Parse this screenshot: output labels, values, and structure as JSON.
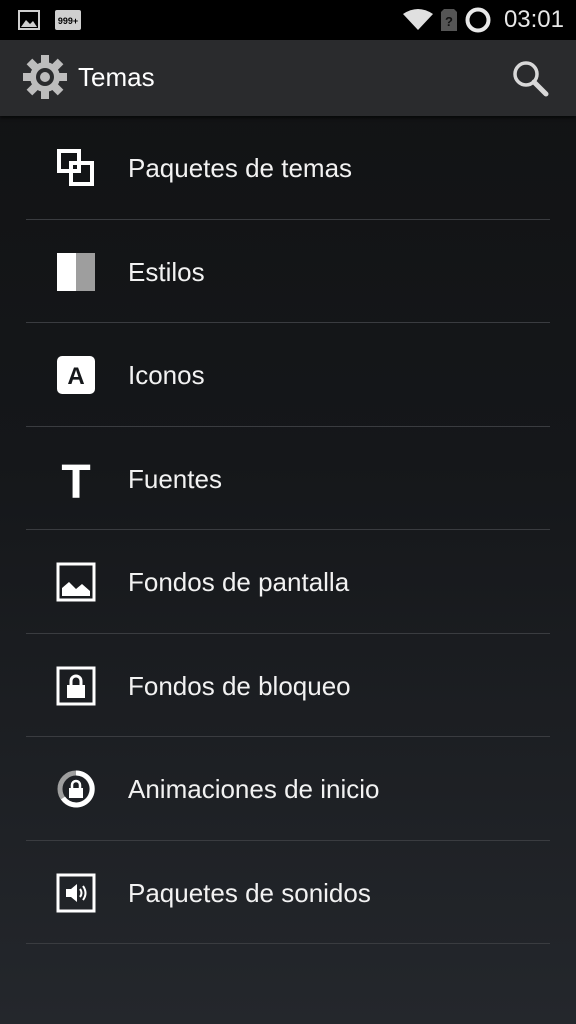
{
  "status_bar": {
    "time": "03:01",
    "notification_badge": "999+",
    "icons": [
      "image-notification-icon",
      "badge-999-icon",
      "wifi-icon",
      "no-sim-icon",
      "sync-ring-icon"
    ]
  },
  "action_bar": {
    "title": "Temas",
    "app_icon": "gear-icon",
    "action_icon": "search-icon"
  },
  "menu": {
    "items": [
      {
        "label": "Paquetes de temas",
        "icon": "overlapping-squares-icon"
      },
      {
        "label": "Estilos",
        "icon": "styles-swatch-icon"
      },
      {
        "label": "Iconos",
        "icon": "letter-a-icon",
        "glyph": "A"
      },
      {
        "label": "Fuentes",
        "icon": "letter-t-icon",
        "glyph": "T"
      },
      {
        "label": "Fondos de pantalla",
        "icon": "wallpaper-icon"
      },
      {
        "label": "Fondos de bloqueo",
        "icon": "lockscreen-icon"
      },
      {
        "label": "Animaciones de inicio",
        "icon": "boot-animation-icon"
      },
      {
        "label": "Paquetes de sonidos",
        "icon": "speaker-icon"
      }
    ]
  }
}
